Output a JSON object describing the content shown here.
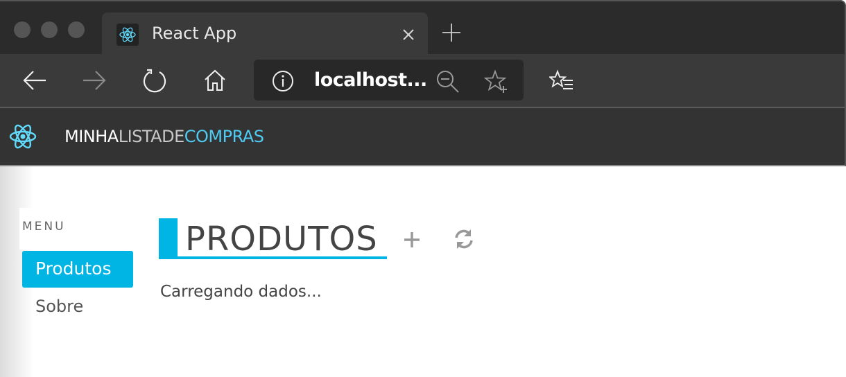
{
  "browser": {
    "tab": {
      "title": "React App",
      "favicon": "react-logo-icon"
    },
    "address_bar": {
      "url": "localhost..."
    },
    "icons": {
      "back": "arrow-left-icon",
      "forward": "arrow-right-icon",
      "refresh": "refresh-icon",
      "home": "home-icon",
      "info": "info-icon",
      "zoom": "zoom-out-icon",
      "add_favorite": "star-plus-icon",
      "favorites": "favorites-list-icon",
      "close_tab": "close-icon",
      "new_tab": "plus-icon"
    }
  },
  "app": {
    "brand": {
      "part1": "MINHA",
      "part2": "LISTADE",
      "part3": "COMPRAS"
    },
    "colors": {
      "accent": "#00b4e4",
      "brand_highlight": "#4fcaf2",
      "header_bg": "#333333"
    }
  },
  "sidebar": {
    "title": "MENU",
    "items": [
      {
        "label": "Produtos",
        "active": true
      },
      {
        "label": "Sobre",
        "active": false
      }
    ]
  },
  "main": {
    "title": "PRODUTOS",
    "status": "Carregando dados...",
    "actions": {
      "add": "plus-icon",
      "reload": "sync-icon"
    }
  }
}
